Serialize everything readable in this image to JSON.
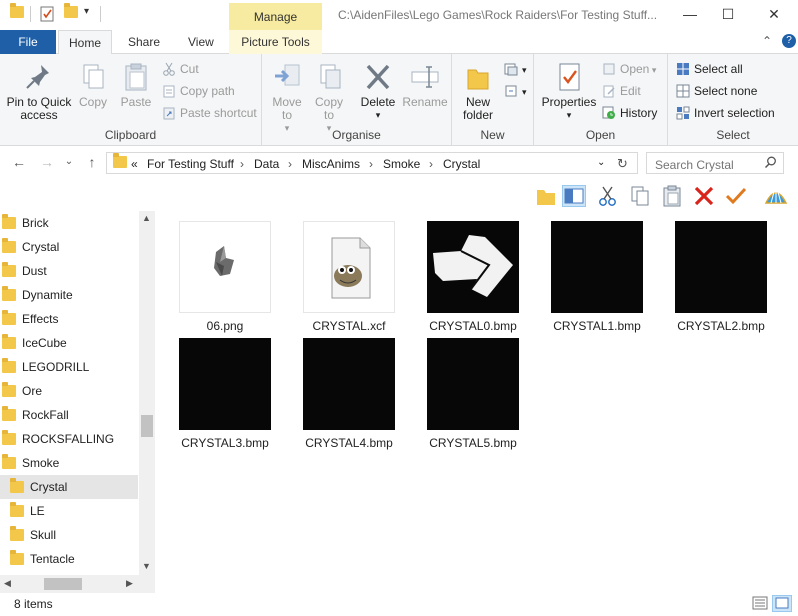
{
  "title_bar": {
    "manage_label": "Manage",
    "path": "C:\\AidenFiles\\Lego Games\\Rock Raiders\\For Testing Stuff...",
    "minimize": "—",
    "maximize": "☐",
    "close": "✕"
  },
  "tabs": {
    "file": "File",
    "home": "Home",
    "share": "Share",
    "view": "View",
    "picture_tools": "Picture Tools",
    "collapse": "⌃",
    "help": "?"
  },
  "ribbon": {
    "clipboard": {
      "label": "Clipboard",
      "pin": "Pin to Quick access",
      "copy": "Copy",
      "paste": "Paste",
      "cut": "Cut",
      "copy_path": "Copy path",
      "paste_shortcut": "Paste shortcut"
    },
    "organise": {
      "label": "Organise",
      "move_to": "Move to",
      "copy_to": "Copy to",
      "delete": "Delete",
      "rename": "Rename"
    },
    "new": {
      "label": "New",
      "new_folder": "New folder"
    },
    "open": {
      "label": "Open",
      "properties": "Properties",
      "open": "Open",
      "edit": "Edit",
      "history": "History"
    },
    "select": {
      "label": "Select",
      "select_all": "Select all",
      "select_none": "Select none",
      "invert": "Invert selection"
    }
  },
  "address": {
    "overflow": "«",
    "crumbs": [
      "For Testing Stuff",
      "Data",
      "MiscAnims",
      "Smoke",
      "Crystal"
    ],
    "search_placeholder": "Search Crystal"
  },
  "nav": {
    "items": [
      "Brick",
      "Crystal",
      "Dust",
      "Dynamite",
      "Effects",
      "IceCube",
      "LEGODRILL",
      "Ore",
      "RockFall",
      "ROCKSFALLING",
      "Smoke",
      "Crystal",
      "LE",
      "Skull",
      "Tentacle"
    ],
    "selected_index": 11
  },
  "files": [
    {
      "name": "06.png",
      "thumb": "white"
    },
    {
      "name": "CRYSTAL.xcf",
      "thumb": "gimp"
    },
    {
      "name": "CRYSTAL0.bmp",
      "thumb": "arrow"
    },
    {
      "name": "CRYSTAL1.bmp",
      "thumb": "black"
    },
    {
      "name": "CRYSTAL2.bmp",
      "thumb": "black"
    },
    {
      "name": "CRYSTAL3.bmp",
      "thumb": "black"
    },
    {
      "name": "CRYSTAL4.bmp",
      "thumb": "black"
    },
    {
      "name": "CRYSTAL5.bmp",
      "thumb": "black"
    }
  ],
  "status": {
    "count": "8 items"
  },
  "colors": {
    "file_tab": "#1e5fa8",
    "manage_tab": "#f6eba0",
    "folder": "#f3c84a"
  }
}
